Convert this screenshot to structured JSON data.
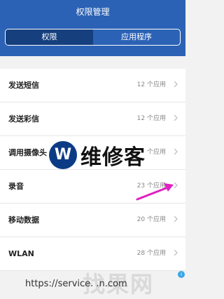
{
  "header": {
    "title": "权限管理",
    "tabs": [
      {
        "label": "权限",
        "active": true
      },
      {
        "label": "应用程序",
        "active": false
      }
    ]
  },
  "permissions": [
    {
      "label": "发送短信",
      "count": "12 个应用"
    },
    {
      "label": "发送彩信",
      "count": "12 个应用"
    },
    {
      "label": "调用摄像头",
      "count": "个应用"
    },
    {
      "label": "录音",
      "count": "23 个应用"
    },
    {
      "label": "移动数据",
      "count": "20 个应用"
    },
    {
      "label": "WLAN",
      "count": "28 个应用"
    }
  ],
  "watermark": {
    "logo_letter": "W",
    "brand_text": "维修客",
    "url": "https://service.                    .n.com",
    "corner_text": "找果网",
    "ad_badge": "i"
  },
  "colors": {
    "header_bg": "#2b62b5",
    "active_tab_bg": "#163f7e",
    "annotation_arrow": "#e020c0"
  },
  "icons": {
    "row_chevron": "chevron-right-icon",
    "annotation": "arrow-icon"
  }
}
